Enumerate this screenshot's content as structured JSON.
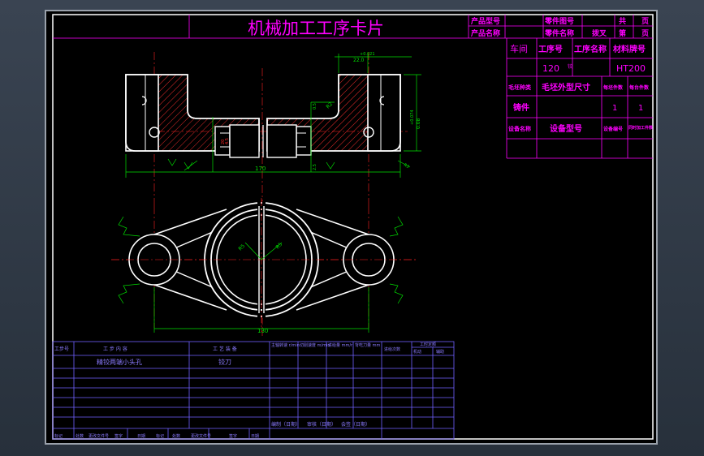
{
  "header": {
    "title": "机械加工工序卡片",
    "product_model_label": "产品型号",
    "product_name_label": "产品名称",
    "part_drawing_no_label": "零件图号",
    "part_name_label": "零件名称",
    "part_name_value": "拨叉",
    "total_label": "共",
    "page_unit_label": "页",
    "sheet_label": "第",
    "sheet_unit_label": "页"
  },
  "info": {
    "workshop_label": "车间",
    "op_no_label": "工序号",
    "op_name_label": "工序名称",
    "material_label": "材料牌号",
    "op_no_value": "120",
    "op_name_value": "铰",
    "material_value": "HT200",
    "blank_type_label": "毛坯种类",
    "blank_size_label": "毛坯外型尺寸",
    "blank_count_label": "每坯件数",
    "per_unit_label": "每台件数",
    "blank_type_value": "铸件",
    "blank_count_value": "1",
    "per_unit_value": "1",
    "equip_name_label": "设备名称",
    "equip_model_label": "设备型号",
    "equip_no_label": "设备编号",
    "concurrent_label": "同时加工件数"
  },
  "drawing": {
    "dim_top_offset": "22.0",
    "dim_top_tol": "+0.021",
    "dim_height_tol": "+0.074",
    "dim_height": "0.08",
    "dim_len_top": "170",
    "dim_len_bottom": "130",
    "dim_small_a": "0.5",
    "dim_small_b": "R2",
    "dim_small_c": "2.5",
    "dim_radius_left": "R5",
    "dim_radius_right": "R5",
    "dim_v1": "20",
    "dim_v2": "4.5",
    "dim_v3": "R3"
  },
  "process_table": {
    "headers": [
      "工步号",
      "工 步 内 容",
      "工 艺 装 备",
      "主轴转速 r/min",
      "切削速度 m/min",
      "进给量 mm/r",
      "背吃刀量 mm",
      "进给次数",
      "工时定额"
    ],
    "time_sub_headers": [
      "机动",
      "辅助"
    ],
    "rows": [
      [
        "",
        "精铰两端小头孔",
        "铰刀",
        "",
        "",
        "",
        "",
        "",
        "",
        ""
      ]
    ],
    "sign_labels": [
      "编制（日期）",
      "审核（日期）",
      "会签（日期）"
    ],
    "revision_labels": [
      "标记",
      "处数",
      "更改文件号",
      "签字",
      "日期",
      "标记",
      "处数",
      "更改文件号",
      "签字",
      "日期"
    ]
  }
}
